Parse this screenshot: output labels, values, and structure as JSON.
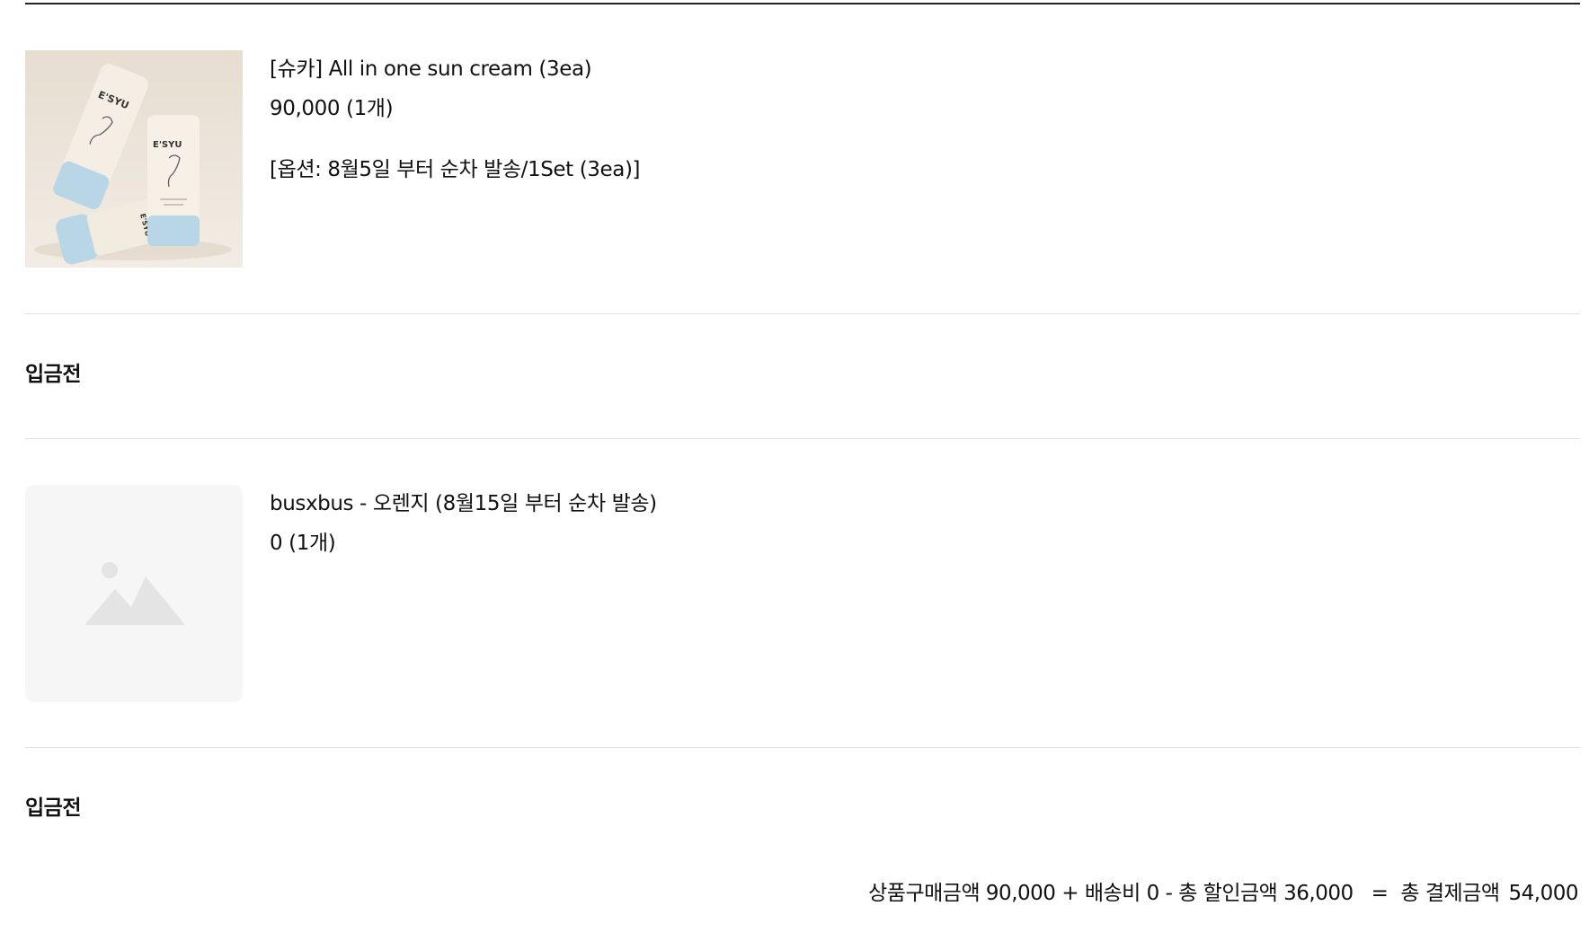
{
  "items": [
    {
      "name": "[슈카] All in one sun cream (3ea)",
      "price": "90,000",
      "quantity": "(1개)",
      "option": "[옵션: 8월5일 부터 순차 발송/1Set (3ea)]",
      "status": "입금전",
      "image": "product-photo-sun-cream",
      "brand_text": "E'SYU"
    },
    {
      "name": "busxbus - 오렌지 (8월15일 부터 순차 발송)",
      "price": "0",
      "quantity": "(1개)",
      "status": "입금전",
      "image": "image-placeholder-icon"
    }
  ],
  "summary": {
    "product_label": "상품구매금액",
    "product_amount": "90,000",
    "plus": "+",
    "shipping_label": "배송비",
    "shipping_amount": "0",
    "minus": "-",
    "discount_label": "총 할인금액",
    "discount_amount": "36,000",
    "equals": "=",
    "total_label": "총 결제금액",
    "total_amount": "54,000"
  },
  "colors": {
    "text": "#111111",
    "divider": "#e2e2e2",
    "placeholder_bg": "#f6f6f6",
    "placeholder_icon": "#e4e4e4",
    "product_bg": "#e8dfd4",
    "tube_cream": "#f2ebe0",
    "tube_blue": "#b9d6e6"
  }
}
